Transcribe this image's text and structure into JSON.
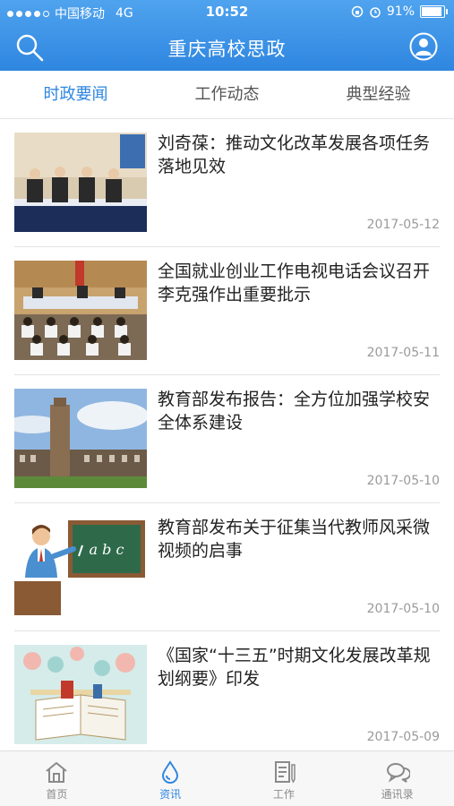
{
  "status": {
    "carrier": "中国移动",
    "network": "4G",
    "time": "10:52",
    "battery": "91%",
    "battery_level": 0.91
  },
  "header": {
    "title": "重庆高校思政"
  },
  "tabs": [
    {
      "label": "时政要闻",
      "active": true
    },
    {
      "label": "工作动态",
      "active": false
    },
    {
      "label": "典型经验",
      "active": false
    }
  ],
  "news": [
    {
      "title": "刘奇葆：推动文化改革发展各项任务落地见效",
      "date": "2017-05-12"
    },
    {
      "title": "全国就业创业工作电视电话会议召开 李克强作出重要批示",
      "date": "2017-05-11"
    },
    {
      "title": "教育部发布报告：全方位加强学校安全体系建设",
      "date": "2017-05-10"
    },
    {
      "title": "教育部发布关于征集当代教师风采微视频的启事",
      "date": "2017-05-10"
    },
    {
      "title": "《国家“十三五”时期文化发展改革规划纲要》印发",
      "date": "2017-05-09"
    }
  ],
  "bottom_nav": [
    {
      "label": "首页",
      "icon": "home-icon",
      "active": false
    },
    {
      "label": "资讯",
      "icon": "drop-icon",
      "active": true
    },
    {
      "label": "工作",
      "icon": "document-icon",
      "active": false
    },
    {
      "label": "通讯录",
      "icon": "chat-icon",
      "active": false
    }
  ],
  "colors": {
    "primary": "#2f86e0",
    "text": "#222222",
    "muted": "#9a9a9a"
  },
  "thumbnails": {
    "board_text": "a b c"
  }
}
